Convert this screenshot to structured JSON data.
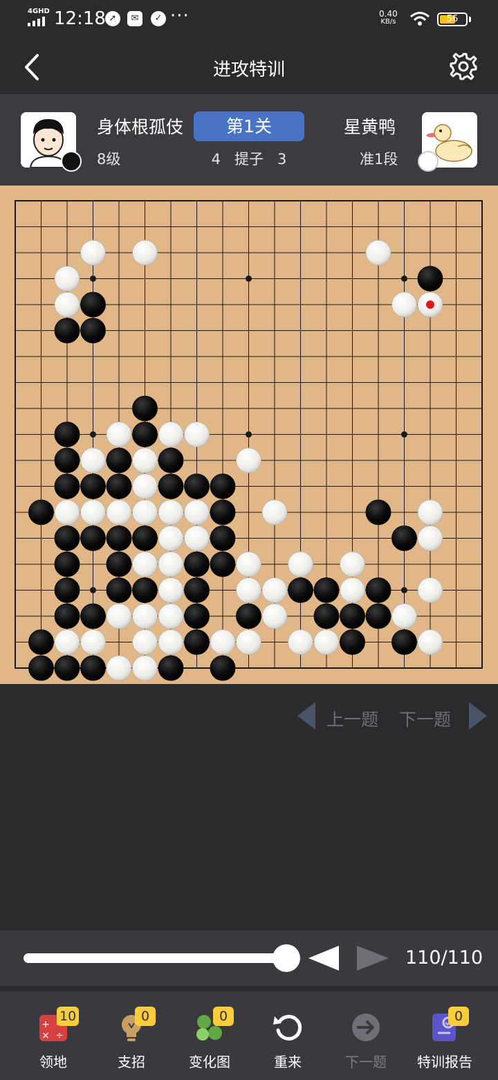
{
  "status_bar": {
    "network": "4GHD",
    "time": "12:18",
    "speed_value": "0.40",
    "speed_unit": "KB/s",
    "battery": "56",
    "battery_color": "#f4c21c"
  },
  "header": {
    "title": "进攻特训",
    "back_icon": "chevron-left-icon",
    "settings_icon": "gear-icon"
  },
  "players": {
    "black": {
      "name": "身体根孤伎",
      "rank": "8级",
      "stone": "black"
    },
    "white": {
      "name": "星黄鸭",
      "rank": "准1段",
      "stone": "white"
    },
    "level": "第1关",
    "capture": {
      "black": "4",
      "label": "提子",
      "white": "3"
    },
    "level_color": "#4a73c6"
  },
  "board": {
    "size": 19,
    "board_color": "#e2b787",
    "last_move_marker": "#e3141b",
    "stones": {
      "black": [
        [
          16,
          3
        ],
        [
          3,
          4
        ],
        [
          2,
          5
        ],
        [
          3,
          5
        ],
        [
          5,
          8
        ],
        [
          2,
          9
        ],
        [
          5,
          9
        ],
        [
          2,
          10
        ],
        [
          4,
          10
        ],
        [
          6,
          10
        ],
        [
          2,
          11
        ],
        [
          3,
          11
        ],
        [
          4,
          11
        ],
        [
          6,
          11
        ],
        [
          7,
          11
        ],
        [
          8,
          11
        ],
        [
          1,
          12
        ],
        [
          8,
          12
        ],
        [
          14,
          12
        ],
        [
          2,
          13
        ],
        [
          3,
          13
        ],
        [
          4,
          13
        ],
        [
          5,
          13
        ],
        [
          8,
          13
        ],
        [
          15,
          13
        ],
        [
          2,
          14
        ],
        [
          4,
          14
        ],
        [
          7,
          14
        ],
        [
          8,
          14
        ],
        [
          2,
          15
        ],
        [
          4,
          15
        ],
        [
          5,
          15
        ],
        [
          7,
          15
        ],
        [
          11,
          15
        ],
        [
          12,
          15
        ],
        [
          14,
          15
        ],
        [
          2,
          16
        ],
        [
          3,
          16
        ],
        [
          7,
          16
        ],
        [
          9,
          16
        ],
        [
          12,
          16
        ],
        [
          13,
          16
        ],
        [
          14,
          16
        ],
        [
          1,
          17
        ],
        [
          7,
          17
        ],
        [
          13,
          17
        ],
        [
          15,
          17
        ],
        [
          1,
          18
        ],
        [
          2,
          18
        ],
        [
          3,
          18
        ],
        [
          6,
          18
        ],
        [
          8,
          18
        ]
      ],
      "white": [
        [
          3,
          2
        ],
        [
          5,
          2
        ],
        [
          14,
          2
        ],
        [
          2,
          3
        ],
        [
          2,
          4
        ],
        [
          15,
          4
        ],
        [
          16,
          4
        ],
        [
          4,
          9
        ],
        [
          6,
          9
        ],
        [
          7,
          9
        ],
        [
          3,
          10
        ],
        [
          5,
          10
        ],
        [
          9,
          10
        ],
        [
          5,
          11
        ],
        [
          2,
          12
        ],
        [
          3,
          12
        ],
        [
          4,
          12
        ],
        [
          5,
          12
        ],
        [
          6,
          12
        ],
        [
          7,
          12
        ],
        [
          10,
          12
        ],
        [
          16,
          12
        ],
        [
          6,
          13
        ],
        [
          7,
          13
        ],
        [
          16,
          13
        ],
        [
          5,
          14
        ],
        [
          6,
          14
        ],
        [
          9,
          14
        ],
        [
          11,
          14
        ],
        [
          13,
          14
        ],
        [
          6,
          15
        ],
        [
          9,
          15
        ],
        [
          10,
          15
        ],
        [
          13,
          15
        ],
        [
          16,
          15
        ],
        [
          4,
          16
        ],
        [
          5,
          16
        ],
        [
          6,
          16
        ],
        [
          10,
          16
        ],
        [
          15,
          16
        ],
        [
          2,
          17
        ],
        [
          3,
          17
        ],
        [
          5,
          17
        ],
        [
          6,
          17
        ],
        [
          8,
          17
        ],
        [
          9,
          17
        ],
        [
          11,
          17
        ],
        [
          12,
          17
        ],
        [
          16,
          17
        ],
        [
          4,
          18
        ],
        [
          5,
          18
        ]
      ]
    },
    "last_move": [
      16,
      4
    ]
  },
  "nav": {
    "prev_label": "上一题",
    "next_label": "下一题"
  },
  "slider": {
    "progress": 1.0,
    "move_count": "110/110"
  },
  "toolbar": {
    "items": [
      {
        "label": "领地",
        "icon": "territory-calculator-icon",
        "badge": "10"
      },
      {
        "label": "支招",
        "icon": "hint-lightbulb-icon",
        "badge": "0"
      },
      {
        "label": "变化图",
        "icon": "variation-stones-icon",
        "badge": "0"
      },
      {
        "label": "重来",
        "icon": "restart-icon"
      },
      {
        "label": "下一题",
        "icon": "next-arrow-icon"
      },
      {
        "label": "特训报告",
        "icon": "report-icon",
        "badge": "0"
      }
    ]
  }
}
